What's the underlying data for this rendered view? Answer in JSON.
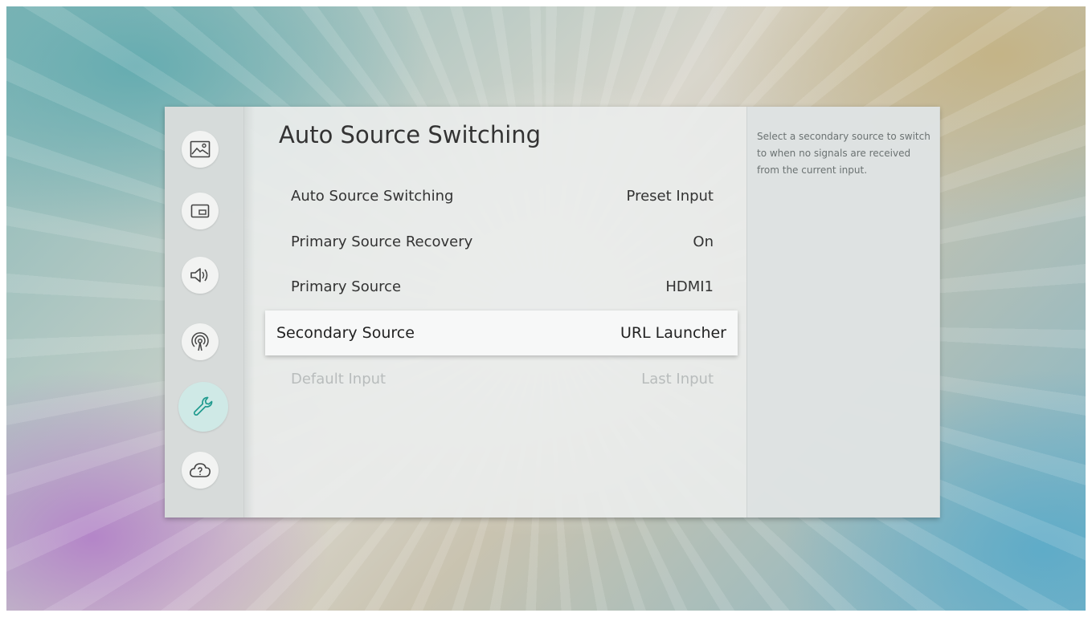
{
  "sidebar": {
    "icons": [
      {
        "name": "picture-icon"
      },
      {
        "name": "picture-in-picture-icon"
      },
      {
        "name": "sound-icon"
      },
      {
        "name": "network-icon"
      },
      {
        "name": "system-wrench-icon",
        "active": true
      },
      {
        "name": "support-icon"
      }
    ],
    "accent": "#1f9a8e"
  },
  "main": {
    "title": "Auto Source Switching",
    "items": [
      {
        "label": "Auto Source Switching",
        "value": "Preset Input"
      },
      {
        "label": "Primary Source Recovery",
        "value": "On"
      },
      {
        "label": "Primary Source",
        "value": "HDMI1"
      },
      {
        "label": "Secondary Source",
        "value": "URL Launcher",
        "selected": true
      },
      {
        "label": "Default Input",
        "value": "Last Input",
        "disabled": true
      }
    ]
  },
  "help": {
    "text": "Select a secondary source to switch to when no signals are received from the current input."
  }
}
